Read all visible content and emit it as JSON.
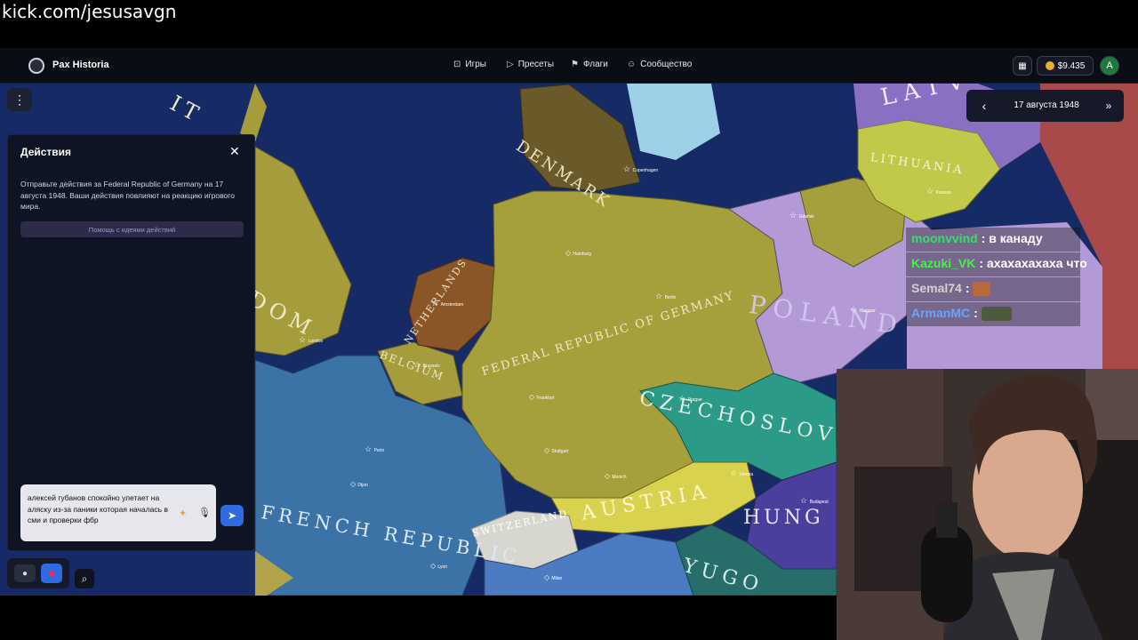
{
  "browser": {
    "url": "kick.com/jesusavgn"
  },
  "app": {
    "name": "Pax Historia"
  },
  "nav": [
    {
      "icon": "gamepad-icon",
      "label": "Игры"
    },
    {
      "icon": "play-icon",
      "label": "Пресеты"
    },
    {
      "icon": "flag-icon",
      "label": "Флаги"
    },
    {
      "icon": "users-icon",
      "label": "Сообщество"
    }
  ],
  "account": {
    "balance": "$9.435",
    "avatar_letter": "A"
  },
  "date": {
    "current": "17 августа 1948"
  },
  "actions_panel": {
    "title": "Действия",
    "description": "Отправьте действия за Federal Republic of Germany на 17 августа 1948. Ваши действия повлияют на реакцию игрового мира.",
    "help_button": "Помощь с идеями действий",
    "input_value": "алексей губанов спокойно улетает на аляску из-за паники которая началась в сми и проверки фбр"
  },
  "map_labels": {
    "denmark": "DENMARK",
    "lithuania": "LITHUANIA",
    "latvia": "LATV",
    "frg": "FEDERAL REPUBLIC OF GERMANY",
    "poland": "POLAND",
    "netherlands": "NETHERLANDS",
    "belgium": "BELGIUM",
    "czech": "CZECHOSLOV",
    "austria": "AUSTRIA",
    "hungary": "HUNG",
    "switzerland": "SWITZERLAND",
    "france": "FRENCH REPUBLIC",
    "yugo": "YUGO",
    "uk": "DOM",
    "uk2": "IT"
  },
  "cities": [
    "Copenhagen",
    "Hamburg",
    "Berlin",
    "Frankfurt",
    "Stuttgart",
    "Munich",
    "Amsterdam",
    "Brussels",
    "Paris",
    "London",
    "Vienna",
    "Budapest",
    "Prague",
    "Warsaw",
    "Kaunas",
    "Gdańsk",
    "Milan",
    "Lyon",
    "Dijon"
  ],
  "chat": [
    {
      "user": "moonvvind",
      "color": "#33e06a",
      "text": "в канаду"
    },
    {
      "user": "Kazuki_VK",
      "color": "#47f04f",
      "text": "ахахахахаха что"
    },
    {
      "user": "Semal74",
      "color": "#d3d3d3",
      "text": "",
      "emote_color": "#b86a3a"
    },
    {
      "user": "ArmanMC",
      "color": "#6aa4ff",
      "text": "",
      "emote_color": "#4d5a3c"
    }
  ],
  "colors": {
    "accent": "#2f6ae0",
    "frg": "#a6a03c",
    "poland": "#b39ad6",
    "france": "#3b77a8"
  }
}
